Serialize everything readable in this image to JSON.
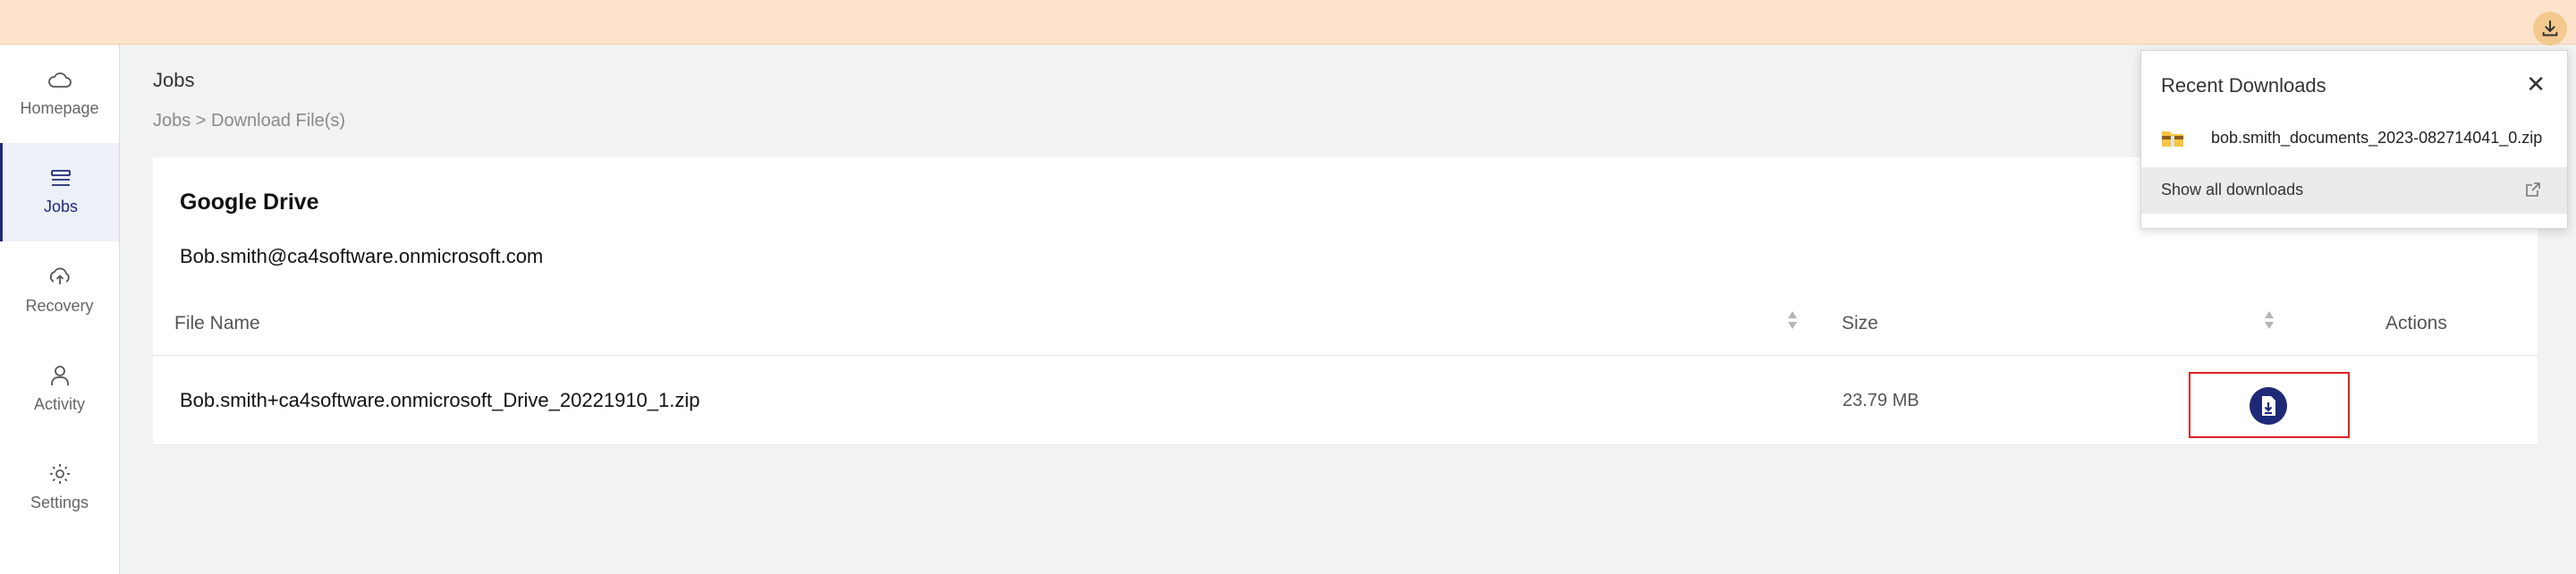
{
  "sidebar": {
    "items": [
      {
        "label": "Homepage",
        "icon": "cloud-icon"
      },
      {
        "label": "Jobs",
        "icon": "jobs-icon"
      },
      {
        "label": "Recovery",
        "icon": "recovery-icon"
      },
      {
        "label": "Activity",
        "icon": "user-icon"
      },
      {
        "label": "Settings",
        "icon": "gear-icon"
      }
    ]
  },
  "page": {
    "title": "Jobs",
    "breadcrumb": "Jobs > Download File(s)"
  },
  "card": {
    "service": "Google Drive",
    "account": "Bob.smith@ca4software.onmicrosoft.com",
    "columns": [
      "File Name",
      "Size",
      "Actions"
    ],
    "rows": [
      {
        "file_name": "Bob.smith+ca4software.onmicrosoft_Drive_20221910_1.zip",
        "size": "23.79 MB"
      }
    ]
  },
  "downloads_panel": {
    "title": "Recent Downloads",
    "items": [
      {
        "name": "bob.smith_documents_2023-082714041_0.zip"
      }
    ],
    "show_all": "Show all downloads"
  },
  "colors": {
    "topbar": "#fde3cc",
    "accent": "#1e2a78",
    "highlight": "#e02020"
  }
}
